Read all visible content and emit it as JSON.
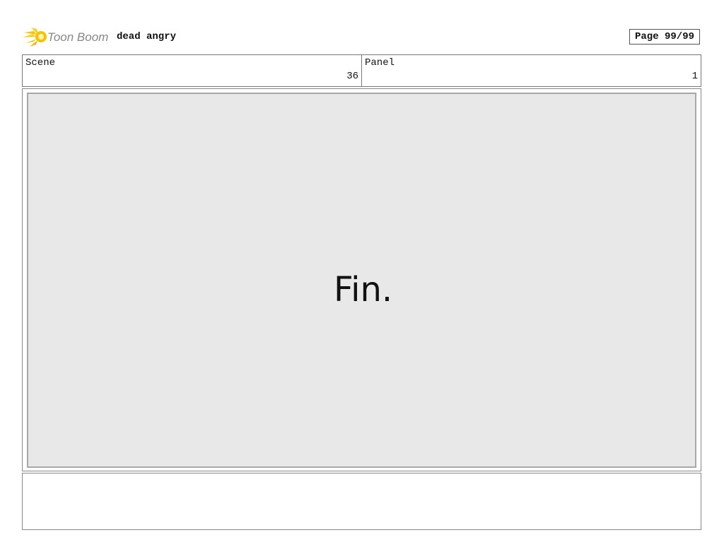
{
  "header": {
    "logo_text": "Toon Boom",
    "project_title": "dead angry",
    "page_label": "Page 99/99"
  },
  "info": {
    "scene_label": "Scene",
    "scene_value": "36",
    "panel_label": "Panel",
    "panel_value": "1"
  },
  "panel": {
    "sketch_text": "Fin."
  },
  "notes": {
    "text": ""
  },
  "colors": {
    "logo_yellow": "#f5c400",
    "logo_text": "#888888",
    "panel_bg": "#e8e8e8"
  }
}
